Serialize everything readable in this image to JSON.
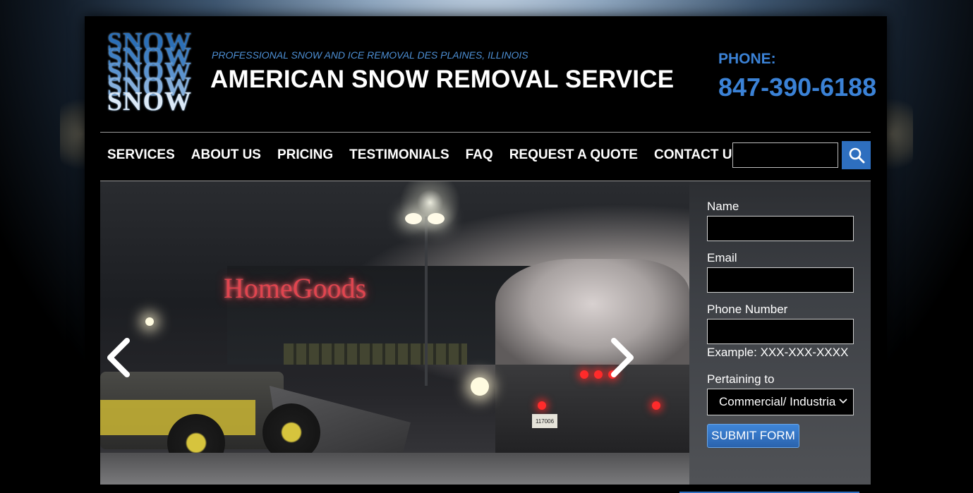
{
  "header": {
    "logo_lines": [
      "SNOW",
      "SNOW",
      "SNOW",
      "SNOW",
      "SNOW"
    ],
    "tagline": "PROFESSIONAL SNOW AND ICE REMOVAL DES PLAINES, ILLINOIS",
    "site_title": "AMERICAN SNOW REMOVAL SERVICE",
    "phone_label": "PHONE:",
    "phone_number": "847-390-6188"
  },
  "nav": {
    "items": [
      {
        "label": "SERVICES"
      },
      {
        "label": "ABOUT US"
      },
      {
        "label": "PRICING"
      },
      {
        "label": "TESTIMONIALS"
      },
      {
        "label": "FAQ"
      },
      {
        "label": "REQUEST A QUOTE"
      },
      {
        "label": "CONTACT US"
      }
    ],
    "search": {
      "value": "",
      "icon": "search-icon"
    }
  },
  "hero": {
    "sign_text": "HomeGoods",
    "plate_text": "117006",
    "prev_icon": "chevron-left-icon",
    "next_icon": "chevron-right-icon"
  },
  "form": {
    "name_label": "Name",
    "name_value": "",
    "email_label": "Email",
    "email_value": "",
    "phone_label": "Phone Number",
    "phone_value": "",
    "phone_hint": "Example: XXX-XXX-XXXX",
    "pertaining_label": "Pertaining to",
    "pertaining_value": "Commercial/ Industria",
    "submit_label": "SUBMIT FORM"
  },
  "colors": {
    "accent": "#3b82d6",
    "button": "#2e6fbf",
    "background": "#000000"
  }
}
